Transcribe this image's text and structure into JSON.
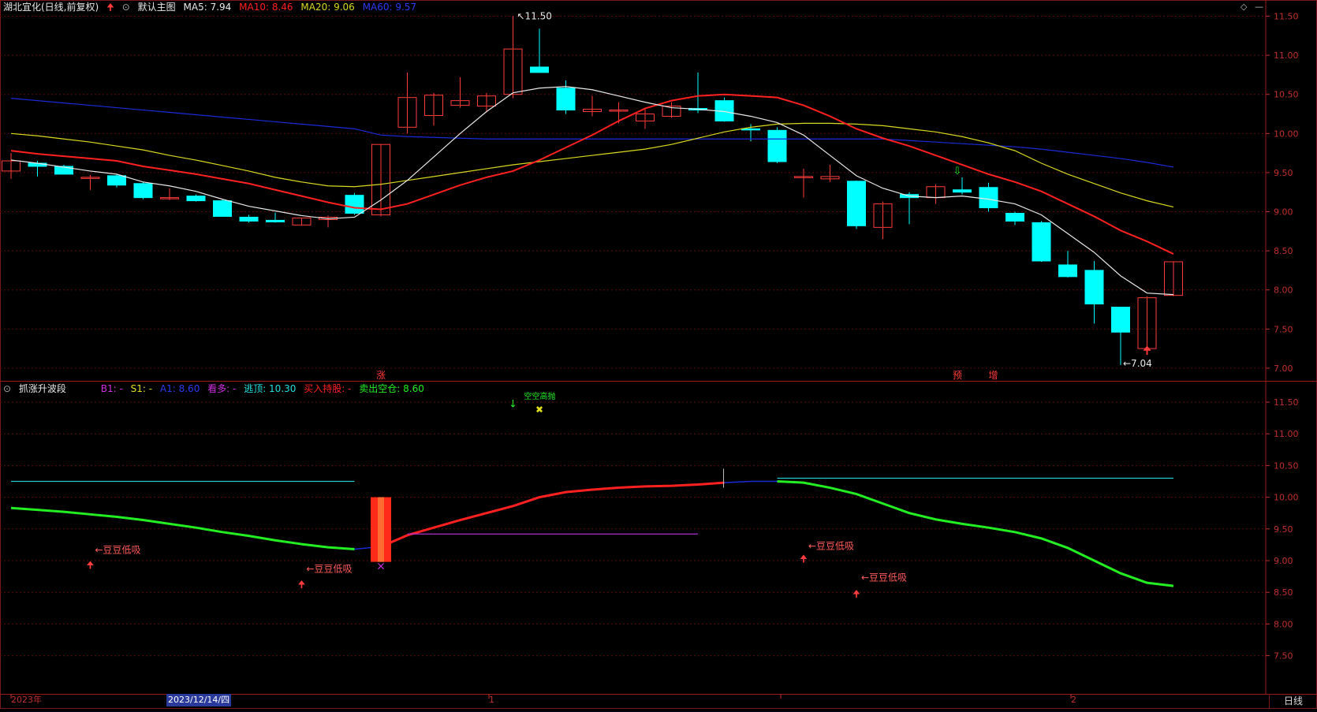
{
  "main_header": {
    "stock_title": "湖北宜化(日线,前复权)",
    "chart_name": "默认主图",
    "ma5": "MA5: 7.94",
    "ma10": "MA10: 8.46",
    "ma20": "MA20: 9.06",
    "ma60": "MA60: 9.57"
  },
  "sub_header": {
    "indicator_name": "抓涨升波段",
    "b1": "B1: -",
    "s1": "S1: -",
    "a1": "A1: 8.60",
    "kanduo": "看多: -",
    "taoding": "逃顶: 10.30",
    "buy_hold": "买入持股: -",
    "sell_empty": "卖出空仓: 8.60"
  },
  "colors": {
    "up": "#ff3b3b",
    "down": "#00ffff",
    "ma5": "#e8e8e8",
    "ma10": "#ff2020",
    "ma20": "#d8d820",
    "ma60": "#1a2ad8",
    "grid": "#5a0c0c",
    "axis": "#c03030",
    "green_line": "#22ee22",
    "red_line": "#ff2020",
    "cyan_line": "#22cccc",
    "purple_line": "#b030d0"
  },
  "price_axis": {
    "ticks": [
      "11.50",
      "11.00",
      "10.50",
      "10.00",
      "9.50",
      "9.00",
      "8.50",
      "8.00",
      "7.50",
      "7.00"
    ]
  },
  "sub_axis": {
    "ticks": [
      "11.50",
      "11.00",
      "10.50",
      "10.00",
      "9.50",
      "9.00",
      "8.50",
      "8.00",
      "7.50"
    ]
  },
  "annotations": {
    "high": "11.50",
    "low": "7.04",
    "mark_zhang": "涨",
    "mark_yu": "预",
    "mark_zeng": "增",
    "low_buy": "豆豆低吸",
    "sub_top_text": "空空高抛"
  },
  "date_axis": {
    "year": "2023年",
    "selected_date": "2023/12/14/四",
    "m1": "1",
    "m2": "2"
  },
  "period_button": "日线",
  "chart_data": {
    "type": "candlestick",
    "candles": [
      {
        "o": 9.52,
        "h": 9.75,
        "l": 9.42,
        "c": 9.65
      },
      {
        "o": 9.62,
        "h": 9.65,
        "l": 9.45,
        "c": 9.58
      },
      {
        "o": 9.58,
        "h": 9.6,
        "l": 9.48,
        "c": 9.48
      },
      {
        "o": 9.44,
        "h": 9.47,
        "l": 9.28,
        "c": 9.44
      },
      {
        "o": 9.46,
        "h": 9.48,
        "l": 9.31,
        "c": 9.34
      },
      {
        "o": 9.36,
        "h": 9.38,
        "l": 9.16,
        "c": 9.18
      },
      {
        "o": 9.18,
        "h": 9.3,
        "l": 9.15,
        "c": 9.18
      },
      {
        "o": 9.2,
        "h": 9.22,
        "l": 9.13,
        "c": 9.14
      },
      {
        "o": 9.14,
        "h": 9.16,
        "l": 8.94,
        "c": 8.94
      },
      {
        "o": 8.93,
        "h": 8.96,
        "l": 8.86,
        "c": 8.88
      },
      {
        "o": 8.89,
        "h": 8.99,
        "l": 8.86,
        "c": 8.87
      },
      {
        "o": 8.83,
        "h": 8.92,
        "l": 8.82,
        "c": 8.92
      },
      {
        "o": 8.9,
        "h": 8.95,
        "l": 8.8,
        "c": 8.93
      },
      {
        "o": 9.21,
        "h": 9.24,
        "l": 8.96,
        "c": 8.98
      },
      {
        "o": 8.96,
        "h": 9.86,
        "l": 8.94,
        "c": 9.86
      },
      {
        "o": 10.08,
        "h": 10.78,
        "l": 10.0,
        "c": 10.46
      },
      {
        "o": 10.23,
        "h": 10.52,
        "l": 10.1,
        "c": 10.49
      },
      {
        "o": 10.36,
        "h": 10.72,
        "l": 10.33,
        "c": 10.42
      },
      {
        "o": 10.35,
        "h": 10.52,
        "l": 10.27,
        "c": 10.48
      },
      {
        "o": 10.5,
        "h": 11.5,
        "l": 10.45,
        "c": 11.08
      },
      {
        "o": 10.85,
        "h": 11.34,
        "l": 10.8,
        "c": 10.78
      },
      {
        "o": 10.58,
        "h": 10.68,
        "l": 10.25,
        "c": 10.3
      },
      {
        "o": 10.28,
        "h": 10.48,
        "l": 10.22,
        "c": 10.31
      },
      {
        "o": 10.3,
        "h": 10.4,
        "l": 10.13,
        "c": 10.3
      },
      {
        "o": 10.16,
        "h": 10.33,
        "l": 10.06,
        "c": 10.25
      },
      {
        "o": 10.22,
        "h": 10.4,
        "l": 10.2,
        "c": 10.35
      },
      {
        "o": 10.32,
        "h": 10.78,
        "l": 10.26,
        "c": 10.3
      },
      {
        "o": 10.42,
        "h": 10.46,
        "l": 10.15,
        "c": 10.16
      },
      {
        "o": 10.06,
        "h": 10.12,
        "l": 9.9,
        "c": 10.05
      },
      {
        "o": 10.04,
        "h": 10.08,
        "l": 9.62,
        "c": 9.64
      },
      {
        "o": 9.45,
        "h": 9.55,
        "l": 9.18,
        "c": 9.45
      },
      {
        "o": 9.42,
        "h": 9.6,
        "l": 9.38,
        "c": 9.45
      },
      {
        "o": 9.39,
        "h": 9.4,
        "l": 8.78,
        "c": 8.82
      },
      {
        "o": 8.8,
        "h": 9.13,
        "l": 8.65,
        "c": 9.1
      },
      {
        "o": 9.22,
        "h": 9.25,
        "l": 8.84,
        "c": 9.18
      },
      {
        "o": 9.18,
        "h": 9.35,
        "l": 9.1,
        "c": 9.32
      },
      {
        "o": 9.28,
        "h": 9.44,
        "l": 9.22,
        "c": 9.25
      },
      {
        "o": 9.31,
        "h": 9.37,
        "l": 9.0,
        "c": 9.05
      },
      {
        "o": 8.98,
        "h": 9.0,
        "l": 8.83,
        "c": 8.88
      },
      {
        "o": 8.86,
        "h": 8.88,
        "l": 8.36,
        "c": 8.37
      },
      {
        "o": 8.32,
        "h": 8.5,
        "l": 8.16,
        "c": 8.17
      },
      {
        "o": 8.25,
        "h": 8.37,
        "l": 7.57,
        "c": 7.82
      },
      {
        "o": 7.78,
        "h": 7.78,
        "l": 7.04,
        "c": 7.46
      },
      {
        "o": 7.25,
        "h": 7.92,
        "l": 7.2,
        "c": 7.9
      },
      {
        "o": 7.93,
        "h": 8.36,
        "l": 7.92,
        "c": 8.36
      }
    ],
    "ma5": [
      9.66,
      9.62,
      9.57,
      9.52,
      9.48,
      9.38,
      9.33,
      9.26,
      9.16,
      9.07,
      9.01,
      8.95,
      8.91,
      8.93,
      9.15,
      9.4,
      9.7,
      10.0,
      10.28,
      10.52,
      10.58,
      10.6,
      10.56,
      10.48,
      10.4,
      10.33,
      10.31,
      10.28,
      10.22,
      10.14,
      9.98,
      9.72,
      9.46,
      9.3,
      9.2,
      9.18,
      9.2,
      9.16,
      9.1,
      8.96,
      8.72,
      8.48,
      8.18,
      7.96,
      7.94
    ],
    "ma10": [
      9.78,
      9.74,
      9.71,
      9.68,
      9.65,
      9.58,
      9.53,
      9.48,
      9.42,
      9.36,
      9.28,
      9.2,
      9.12,
      9.05,
      9.03,
      9.1,
      9.22,
      9.34,
      9.44,
      9.52,
      9.66,
      9.82,
      9.98,
      10.16,
      10.32,
      10.42,
      10.48,
      10.5,
      10.48,
      10.46,
      10.36,
      10.22,
      10.06,
      9.94,
      9.84,
      9.72,
      9.6,
      9.48,
      9.38,
      9.26,
      9.1,
      8.94,
      8.76,
      8.62,
      8.46
    ],
    "ma20": [
      10.0,
      9.97,
      9.93,
      9.89,
      9.84,
      9.79,
      9.72,
      9.66,
      9.59,
      9.52,
      9.44,
      9.38,
      9.33,
      9.32,
      9.35,
      9.4,
      9.45,
      9.5,
      9.55,
      9.6,
      9.64,
      9.68,
      9.72,
      9.76,
      9.8,
      9.86,
      9.94,
      10.02,
      10.08,
      10.12,
      10.13,
      10.13,
      10.12,
      10.1,
      10.06,
      10.02,
      9.96,
      9.88,
      9.78,
      9.62,
      9.48,
      9.36,
      9.24,
      9.14,
      9.06
    ],
    "ma60": [
      10.45,
      10.42,
      10.39,
      10.36,
      10.33,
      10.3,
      10.27,
      10.24,
      10.21,
      10.18,
      10.15,
      10.12,
      10.09,
      10.06,
      9.98,
      9.96,
      9.95,
      9.94,
      9.93,
      9.93,
      9.93,
      9.93,
      9.93,
      9.93,
      9.93,
      9.93,
      9.93,
      9.93,
      9.93,
      9.93,
      9.93,
      9.93,
      9.93,
      9.93,
      9.91,
      9.89,
      9.87,
      9.85,
      9.83,
      9.8,
      9.76,
      9.72,
      9.68,
      9.63,
      9.57
    ],
    "sub": {
      "wave": [
        9.83,
        9.8,
        9.77,
        9.73,
        9.69,
        9.64,
        9.58,
        9.52,
        9.45,
        9.39,
        9.32,
        9.26,
        9.21,
        9.18,
        9.22,
        9.4,
        9.52,
        9.64,
        9.75,
        9.86,
        10.0,
        10.08,
        10.12,
        10.15,
        10.17,
        10.18,
        10.2,
        10.23,
        10.25,
        10.25,
        10.23,
        10.15,
        10.05,
        9.9,
        9.75,
        9.65,
        9.58,
        9.52,
        9.45,
        9.35,
        9.2,
        9.0,
        8.8,
        8.65,
        8.6
      ],
      "top_level": 10.3,
      "purple_level": 9.42,
      "cyan_left_level": 10.25
    }
  }
}
